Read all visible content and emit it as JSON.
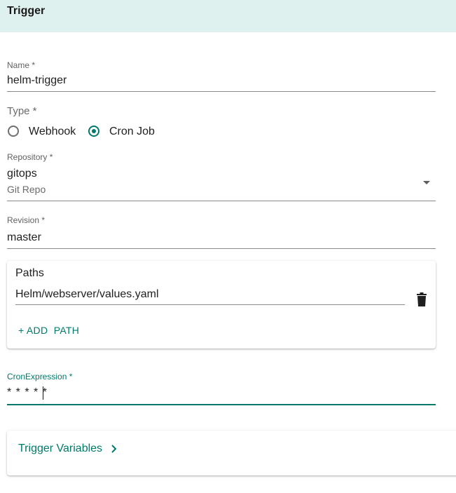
{
  "header": {
    "title": "Trigger"
  },
  "name": {
    "label": "Name *",
    "value": "helm-trigger"
  },
  "type": {
    "label": "Type *",
    "options": [
      {
        "label": "Webhook",
        "selected": false
      },
      {
        "label": "Cron Job",
        "selected": true
      }
    ]
  },
  "repository": {
    "label": "Repository *",
    "value": "gitops",
    "helper": "Git Repo",
    "icon": "dropdown-caret-icon"
  },
  "revision": {
    "label": "Revision *",
    "value": "master"
  },
  "paths": {
    "title": "Paths",
    "items": [
      "Helm/webserver/values.yaml"
    ],
    "delete_icon": "trash-icon",
    "add_label": "+ ADD  PATH"
  },
  "cron": {
    "label": "CronExpression *",
    "value": "* * * * *"
  },
  "trigger_variables": {
    "label": "Trigger Variables",
    "icon": "chevron-right-icon"
  },
  "colors": {
    "accent": "#00796b",
    "header_bg": "#dff1ee"
  }
}
